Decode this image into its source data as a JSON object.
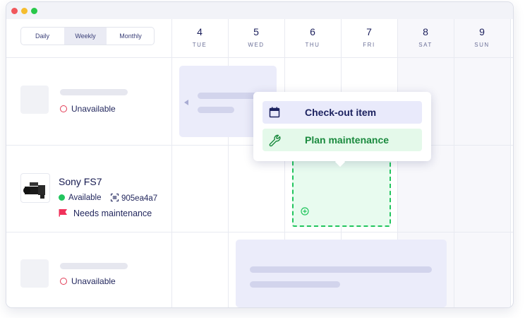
{
  "view_switcher": {
    "options": [
      {
        "label": "Daily"
      },
      {
        "label": "Weekly",
        "active": true
      },
      {
        "label": "Monthly"
      }
    ]
  },
  "days": [
    {
      "num": "4",
      "name": "TUE"
    },
    {
      "num": "5",
      "name": "WED"
    },
    {
      "num": "6",
      "name": "THU"
    },
    {
      "num": "7",
      "name": "FRI"
    },
    {
      "num": "8",
      "name": "SAT"
    },
    {
      "num": "9",
      "name": "SUN"
    }
  ],
  "rows": [
    {
      "status": "Unavailable"
    },
    {
      "name": "Sony FS7",
      "availability": "Available",
      "code": "905ea4a7",
      "flag": "Needs maintenance"
    },
    {
      "status": "Unavailable"
    }
  ],
  "popover": {
    "items": [
      {
        "label": "Check-out item",
        "icon": "calendar-icon"
      },
      {
        "label": "Plan maintenance",
        "icon": "wrench-icon"
      }
    ]
  },
  "colors": {
    "accent": "#1b1f5c",
    "available": "#22c55e",
    "unavailable": "#e23b55",
    "flag": "#f0315a",
    "booking": "#ebecfa",
    "maintenance": "#e8fbef"
  }
}
